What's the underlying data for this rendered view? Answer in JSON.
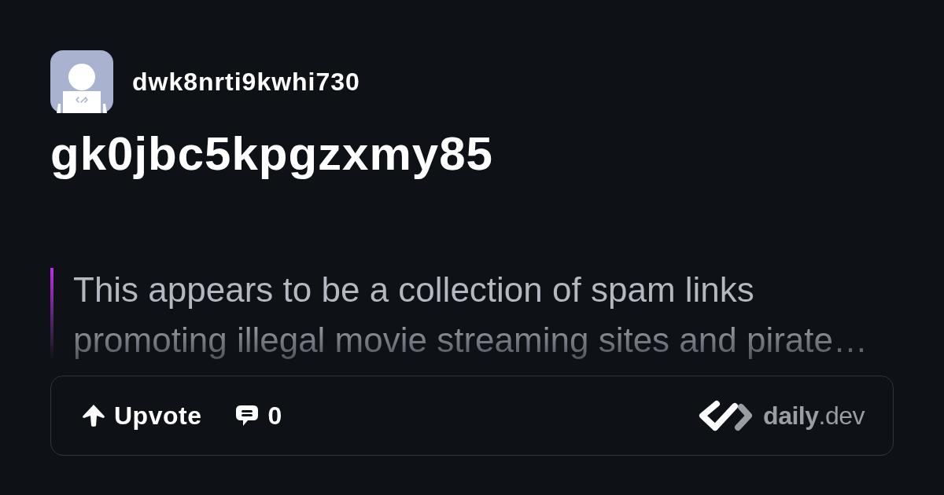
{
  "author": {
    "username": "dwk8nrti9kwhi730"
  },
  "post": {
    "title": "gk0jbc5kpgzxmy85",
    "summary": "This appears to be a collection of spam links promoting illegal movie streaming sites and pirate…"
  },
  "actions": [
    {
      "kind": "upvote",
      "label": "Upvote"
    },
    {
      "kind": "comments",
      "label": "0"
    }
  ],
  "brand": {
    "wordmark": "**daily**.dev"
  }
}
